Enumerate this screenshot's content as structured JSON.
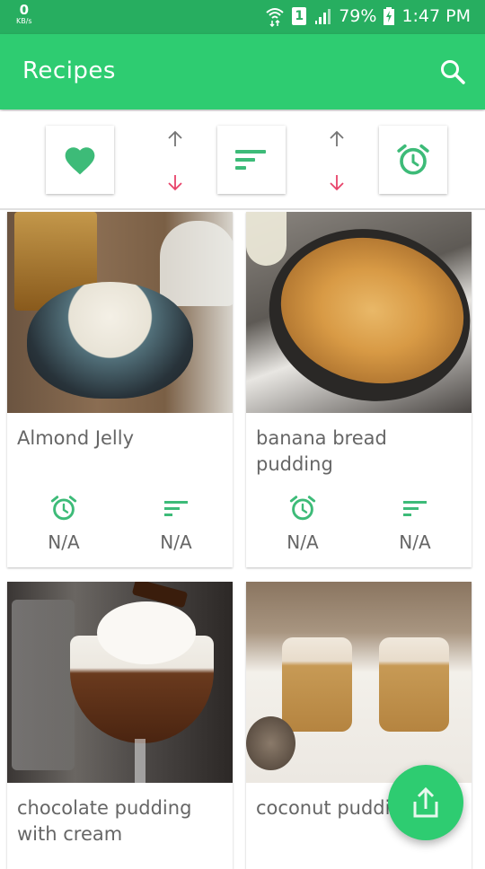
{
  "status_bar": {
    "net_speed": "0",
    "net_unit": "KB/s",
    "sim": "1",
    "battery": "79%",
    "time": "1:47 PM"
  },
  "app_bar": {
    "title": "Recipes",
    "search_icon": "search-icon"
  },
  "sort_bar": {
    "items": [
      {
        "icon": "heart-icon",
        "label": "Favorites"
      },
      {
        "icon": "sort-icon",
        "label": "Difficulty"
      },
      {
        "icon": "alarm-clock-icon",
        "label": "Time"
      }
    ],
    "arrow_up_color": "#757575",
    "arrow_down_color": "#e8436a"
  },
  "recipes": [
    {
      "title": "Almond Jelly",
      "time": "N/A",
      "difficulty": "N/A"
    },
    {
      "title": "banana bread pudding",
      "time": "N/A",
      "difficulty": "N/A"
    },
    {
      "title": "chocolate pudding with cream",
      "time": "",
      "difficulty": ""
    },
    {
      "title": "coconut pudding",
      "time": "",
      "difficulty": ""
    }
  ],
  "fab": {
    "icon": "share-icon"
  },
  "colors": {
    "status_bar": "#27ae60",
    "primary": "#2ecc71",
    "accent_icon": "#3dbb78",
    "text": "#666666"
  }
}
